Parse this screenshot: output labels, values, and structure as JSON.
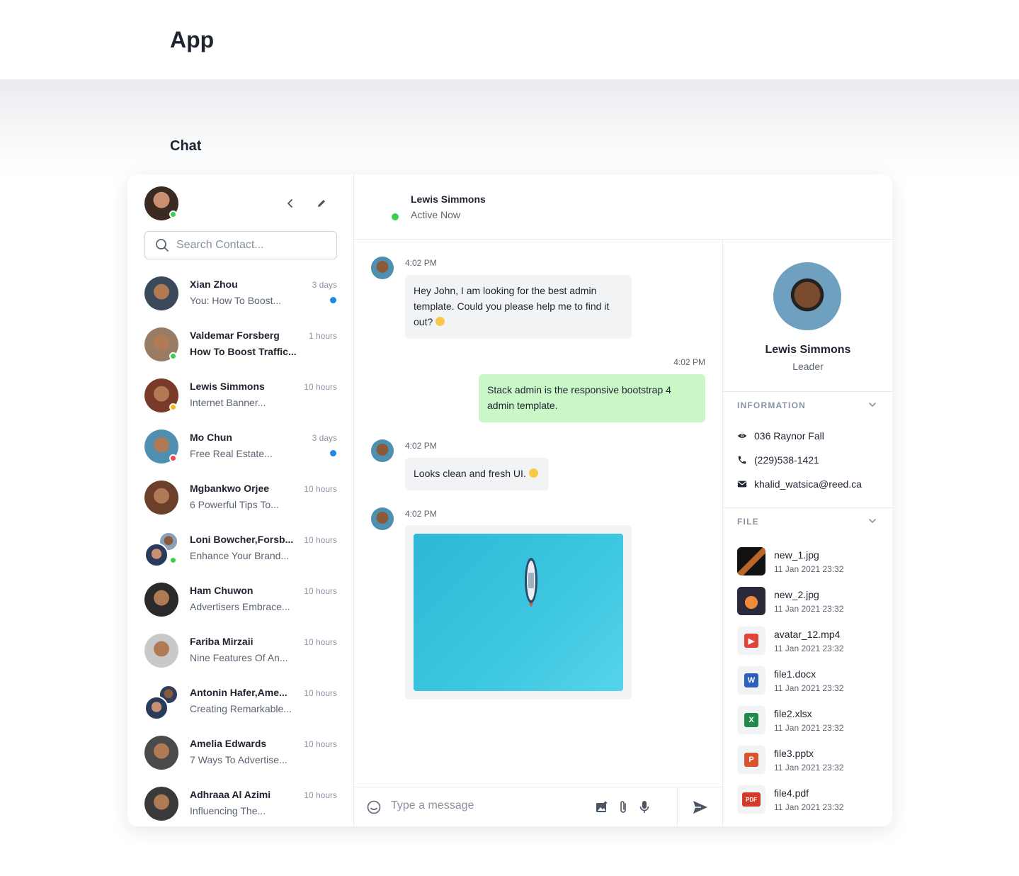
{
  "page": {
    "app_title": "App",
    "section_title": "Chat"
  },
  "sidebar": {
    "search_placeholder": "Search Contact...",
    "contacts": [
      {
        "name": "Xian Zhou",
        "preview": "You: How To Boost...",
        "time": "3 days",
        "unread": true,
        "status": null,
        "bold": false,
        "color": "#3b4a5a"
      },
      {
        "name": "Valdemar Forsberg",
        "preview": "How To Boost Traffic...",
        "time": "1 hours",
        "unread": false,
        "status": "online",
        "bold": true,
        "color": "#9a7c64"
      },
      {
        "name": "Lewis Simmons",
        "preview": "Internet Banner...",
        "time": "10 hours",
        "unread": false,
        "status": "away",
        "bold": false,
        "color": "#7a3a2a"
      },
      {
        "name": "Mo Chun",
        "preview": "Free Real Estate...",
        "time": "3 days",
        "unread": true,
        "status": "busy",
        "bold": false,
        "color": "#4f8fb0"
      },
      {
        "name": "Mgbankwo Orjee",
        "preview": "6 Powerful Tips To...",
        "time": "10 hours",
        "unread": false,
        "status": null,
        "bold": false,
        "color": "#6b3f2a"
      },
      {
        "name": "Loni Bowcher,Forsb...",
        "preview": "Enhance Your Brand...",
        "time": "10 hours",
        "unread": false,
        "status": "online",
        "bold": false,
        "color": "#8aa0b8",
        "group": true
      },
      {
        "name": "Ham Chuwon",
        "preview": "Advertisers Embrace...",
        "time": "10 hours",
        "unread": false,
        "status": null,
        "bold": false,
        "color": "#2a2a2a"
      },
      {
        "name": "Fariba Mirzaii",
        "preview": "Nine Features Of An...",
        "time": "10 hours",
        "unread": false,
        "status": null,
        "bold": false,
        "color": "#c9c9c9"
      },
      {
        "name": "Antonin Hafer,Ame...",
        "preview": "Creating Remarkable...",
        "time": "10 hours",
        "unread": false,
        "status": null,
        "bold": false,
        "color": "#2e3f5c",
        "group": true
      },
      {
        "name": "Amelia Edwards",
        "preview": "7 Ways To Advertise...",
        "time": "10 hours",
        "unread": false,
        "status": null,
        "bold": false,
        "color": "#4a4a4a"
      },
      {
        "name": "Adhraaa Al Azimi",
        "preview": "Influencing The...",
        "time": "10 hours",
        "unread": false,
        "status": null,
        "bold": false,
        "color": "#3a3a3a"
      }
    ]
  },
  "chat": {
    "contact_name": "Lewis Simmons",
    "contact_status": "Active Now",
    "composer_placeholder": "Type a message",
    "messages": [
      {
        "time": "4:02 PM",
        "text": "Hey John, I am looking for the best admin template. Could you please help me to find it out?"
      },
      {
        "time": "4:02 PM",
        "text": "Stack admin is the responsive bootstrap 4 admin template."
      },
      {
        "time": "4:02 PM",
        "text": "Looks clean and fresh UI."
      },
      {
        "time": "4:02 PM"
      }
    ]
  },
  "profile": {
    "name": "Lewis Simmons",
    "role": "Leader",
    "info_heading": "INFORMATION",
    "address": "036 Raynor Fall",
    "phone": "(229)538-1421",
    "email": "khalid_watsica@reed.ca",
    "file_heading": "FILE",
    "files": [
      {
        "name": "new_1.jpg",
        "date": "11 Jan 2021 23:32",
        "kind": "image-dark"
      },
      {
        "name": "new_2.jpg",
        "date": "11 Jan 2021 23:32",
        "kind": "image-fire"
      },
      {
        "name": "avatar_12.mp4",
        "date": "11 Jan 2021 23:32",
        "kind": "video"
      },
      {
        "name": "file1.docx",
        "date": "11 Jan 2021 23:32",
        "kind": "word"
      },
      {
        "name": "file2.xlsx",
        "date": "11 Jan 2021 23:32",
        "kind": "excel"
      },
      {
        "name": "file3.pptx",
        "date": "11 Jan 2021 23:32",
        "kind": "powerpoint"
      },
      {
        "name": "file4.pdf",
        "date": "11 Jan 2021 23:32",
        "kind": "pdf"
      }
    ]
  },
  "colors": {
    "online": "#3ccf4e",
    "away": "#f5b915",
    "busy": "#f0484a",
    "unread": "#1e88e5",
    "my_bubble": "#c9f7c8",
    "bubble": "#f2f3f5"
  }
}
